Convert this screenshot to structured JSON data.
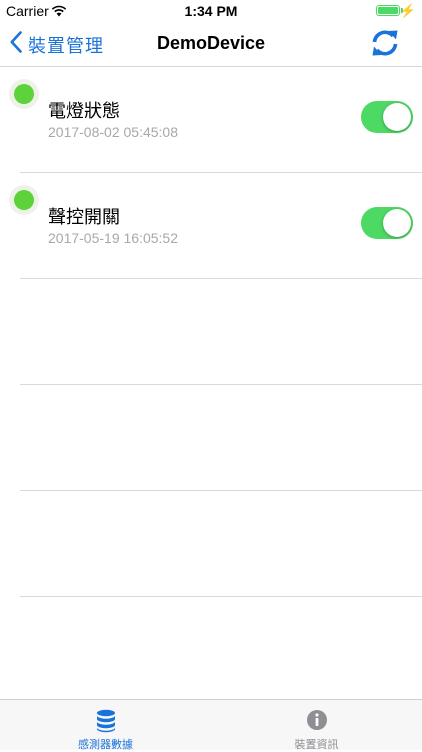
{
  "status_bar": {
    "carrier": "Carrier",
    "time": "1:34 PM"
  },
  "nav": {
    "back_label": "裝置管理",
    "title": "DemoDevice"
  },
  "sensors": [
    {
      "name": "電燈狀態",
      "timestamp": "2017-08-02 05:45:08",
      "on": true
    },
    {
      "name": "聲控開關",
      "timestamp": "2017-05-19 16:05:52",
      "on": true
    }
  ],
  "tabs": [
    {
      "label": "感測器數據",
      "icon": "database-icon",
      "active": true
    },
    {
      "label": "裝置資訊",
      "icon": "info-icon",
      "active": false
    }
  ],
  "colors": {
    "accent": "#1a73d9",
    "toggle_on": "#4cd964",
    "status_dot": "#5dd23a"
  }
}
